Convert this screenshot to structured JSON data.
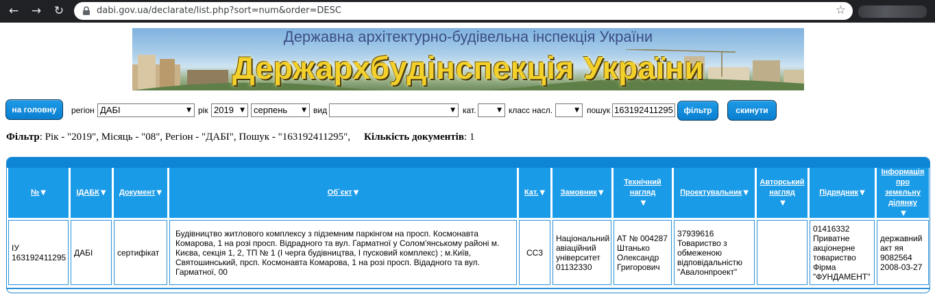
{
  "browser": {
    "url": "dabi.gov.ua/declarate/list.php?sort=num&order=DESC"
  },
  "banner": {
    "subtitle": "Державна архітектурно-будівельна інспекція України",
    "title": "Держархбудінспекція України"
  },
  "filters": {
    "home_button": "на головну",
    "region_label": "регіон",
    "region_value": "ДАБІ",
    "year_label": "рік",
    "year_value": "2019",
    "month_value": "серпень",
    "type_label": "вид",
    "type_value": "",
    "cat_label": "кат.",
    "cat_value": "",
    "class_label": "класс насл.",
    "class_value": "",
    "search_label": "пошук",
    "search_value": "163192411295",
    "filter_button": "фільтр",
    "reset_button": "скинути"
  },
  "summary": {
    "filter_label": "Фільтр",
    "filter_text": ": Рік - \"2019\", Місяць - \"08\", Регіон - \"ДАБІ\", Пошук - \"163192411295\",",
    "count_label": "Кількість документів",
    "count_value": ": 1"
  },
  "table": {
    "headers": [
      "№",
      "ІДАБК",
      "Документ",
      "Об`єкт",
      "Кат.",
      "Замовник",
      "Технічний нагляд",
      "Проектувальник",
      "Авторський нагляд",
      "Підрядник",
      "Інформація про земельну ділянку"
    ],
    "rows": [
      {
        "num": "ІУ 163192411295",
        "idabk": "ДАБІ",
        "document": "сертифікат",
        "object": "Будівництво житлового комплексу з підземним паркінгом на просп. Космонавта Комарова, 1 на розі просп. Відрадного та вул. Гарматної у Солом'янському районі м. Києва, секція 1, 2, ТП № 1 (І черга будівництва, І пусковий комплекс) ; м.Київ, Святошинський, прсп. Космонавта Комарова, 1 на розі просп. Відадного та вул. Гарматної, 00",
        "category": "СС3",
        "customer": "Національний авіаційний університет 01132330",
        "tech_supervision": "АТ № 004287 Штанько Олександр Григорович",
        "designer": "37939616 Товариство з обмеженою відповідальністю \"Авалонпроект\"",
        "author_supervision": "",
        "contractor": "01416332 Приватне акціонерне товариство Фірма \"ФУНДАМЕНТ\"",
        "land_info": "державний акт яя 9082564 2008-03-27"
      }
    ]
  },
  "colors": {
    "accent": "#1a9be8",
    "button": "#0a7fd0",
    "chrome": "#202124"
  }
}
